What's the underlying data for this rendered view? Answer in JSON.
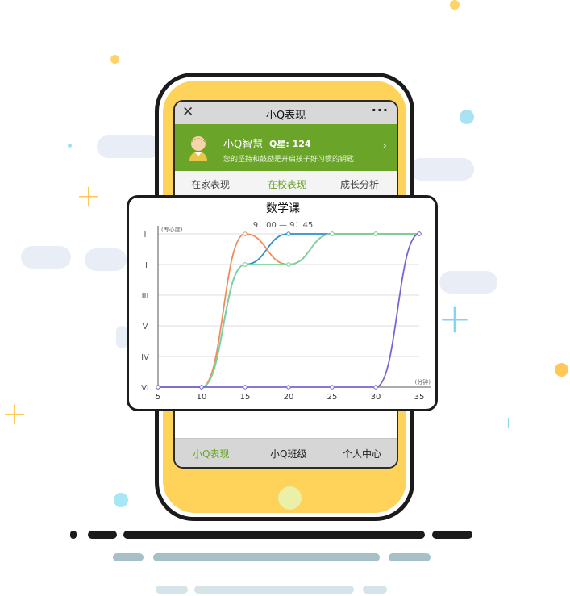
{
  "app": {
    "window_title": "小Q表现",
    "close_glyph": "✕",
    "more_glyph": "···"
  },
  "profile": {
    "name": "小Q智慧",
    "star": "Q星: 124",
    "subtitle": "您的坚持和鼓励是开启孩子好习惯的钥匙",
    "chevron": "›",
    "avatar_icon": "child-avatar-icon"
  },
  "tabs": [
    {
      "label": "在家表现",
      "active": false
    },
    {
      "label": "在校表现",
      "active": true
    },
    {
      "label": "成长分析",
      "active": false
    }
  ],
  "bottom_nav": [
    {
      "label": "小Q表现",
      "active": true
    },
    {
      "label": "小Q班级",
      "active": false
    },
    {
      "label": "个人中心",
      "active": false
    }
  ],
  "colors": {
    "accent_green": "#6aa52a",
    "phone_yellow": "#ffd25a",
    "series_blue": "#2a8fd1",
    "series_orange": "#f08c5a",
    "series_green": "#7dd39b",
    "series_purple": "#7a63d6"
  },
  "chart_data": {
    "type": "line",
    "title": "数学课",
    "subtitle": "9：00 — 9：45",
    "ylabel": "(专心度)",
    "xlabel": "(分钟)",
    "x_ticks": [
      5,
      10,
      15,
      20,
      25,
      30,
      35
    ],
    "y_ticks": [
      "I",
      "II",
      "III",
      "V",
      "IV",
      "VI"
    ],
    "xlim": [
      5,
      35
    ],
    "ylim": [
      1,
      6
    ],
    "grid": true,
    "series": [
      {
        "color_key": "series_blue",
        "points": [
          [
            5,
            6
          ],
          [
            10,
            6
          ],
          [
            15,
            2
          ],
          [
            20,
            1
          ],
          [
            25,
            1
          ],
          [
            30,
            1
          ],
          [
            35,
            1
          ]
        ]
      },
      {
        "color_key": "series_orange",
        "points": [
          [
            5,
            6
          ],
          [
            10,
            6
          ],
          [
            15,
            1
          ],
          [
            20,
            2
          ],
          [
            25,
            1
          ],
          [
            30,
            1
          ],
          [
            35,
            1
          ]
        ]
      },
      {
        "color_key": "series_green",
        "points": [
          [
            5,
            6
          ],
          [
            10,
            6
          ],
          [
            15,
            2
          ],
          [
            20,
            2
          ],
          [
            25,
            1
          ],
          [
            30,
            1
          ],
          [
            35,
            1
          ]
        ]
      },
      {
        "color_key": "series_purple",
        "points": [
          [
            5,
            6
          ],
          [
            10,
            6
          ],
          [
            15,
            6
          ],
          [
            20,
            6
          ],
          [
            25,
            6
          ],
          [
            30,
            6
          ],
          [
            35,
            1
          ]
        ]
      }
    ]
  }
}
